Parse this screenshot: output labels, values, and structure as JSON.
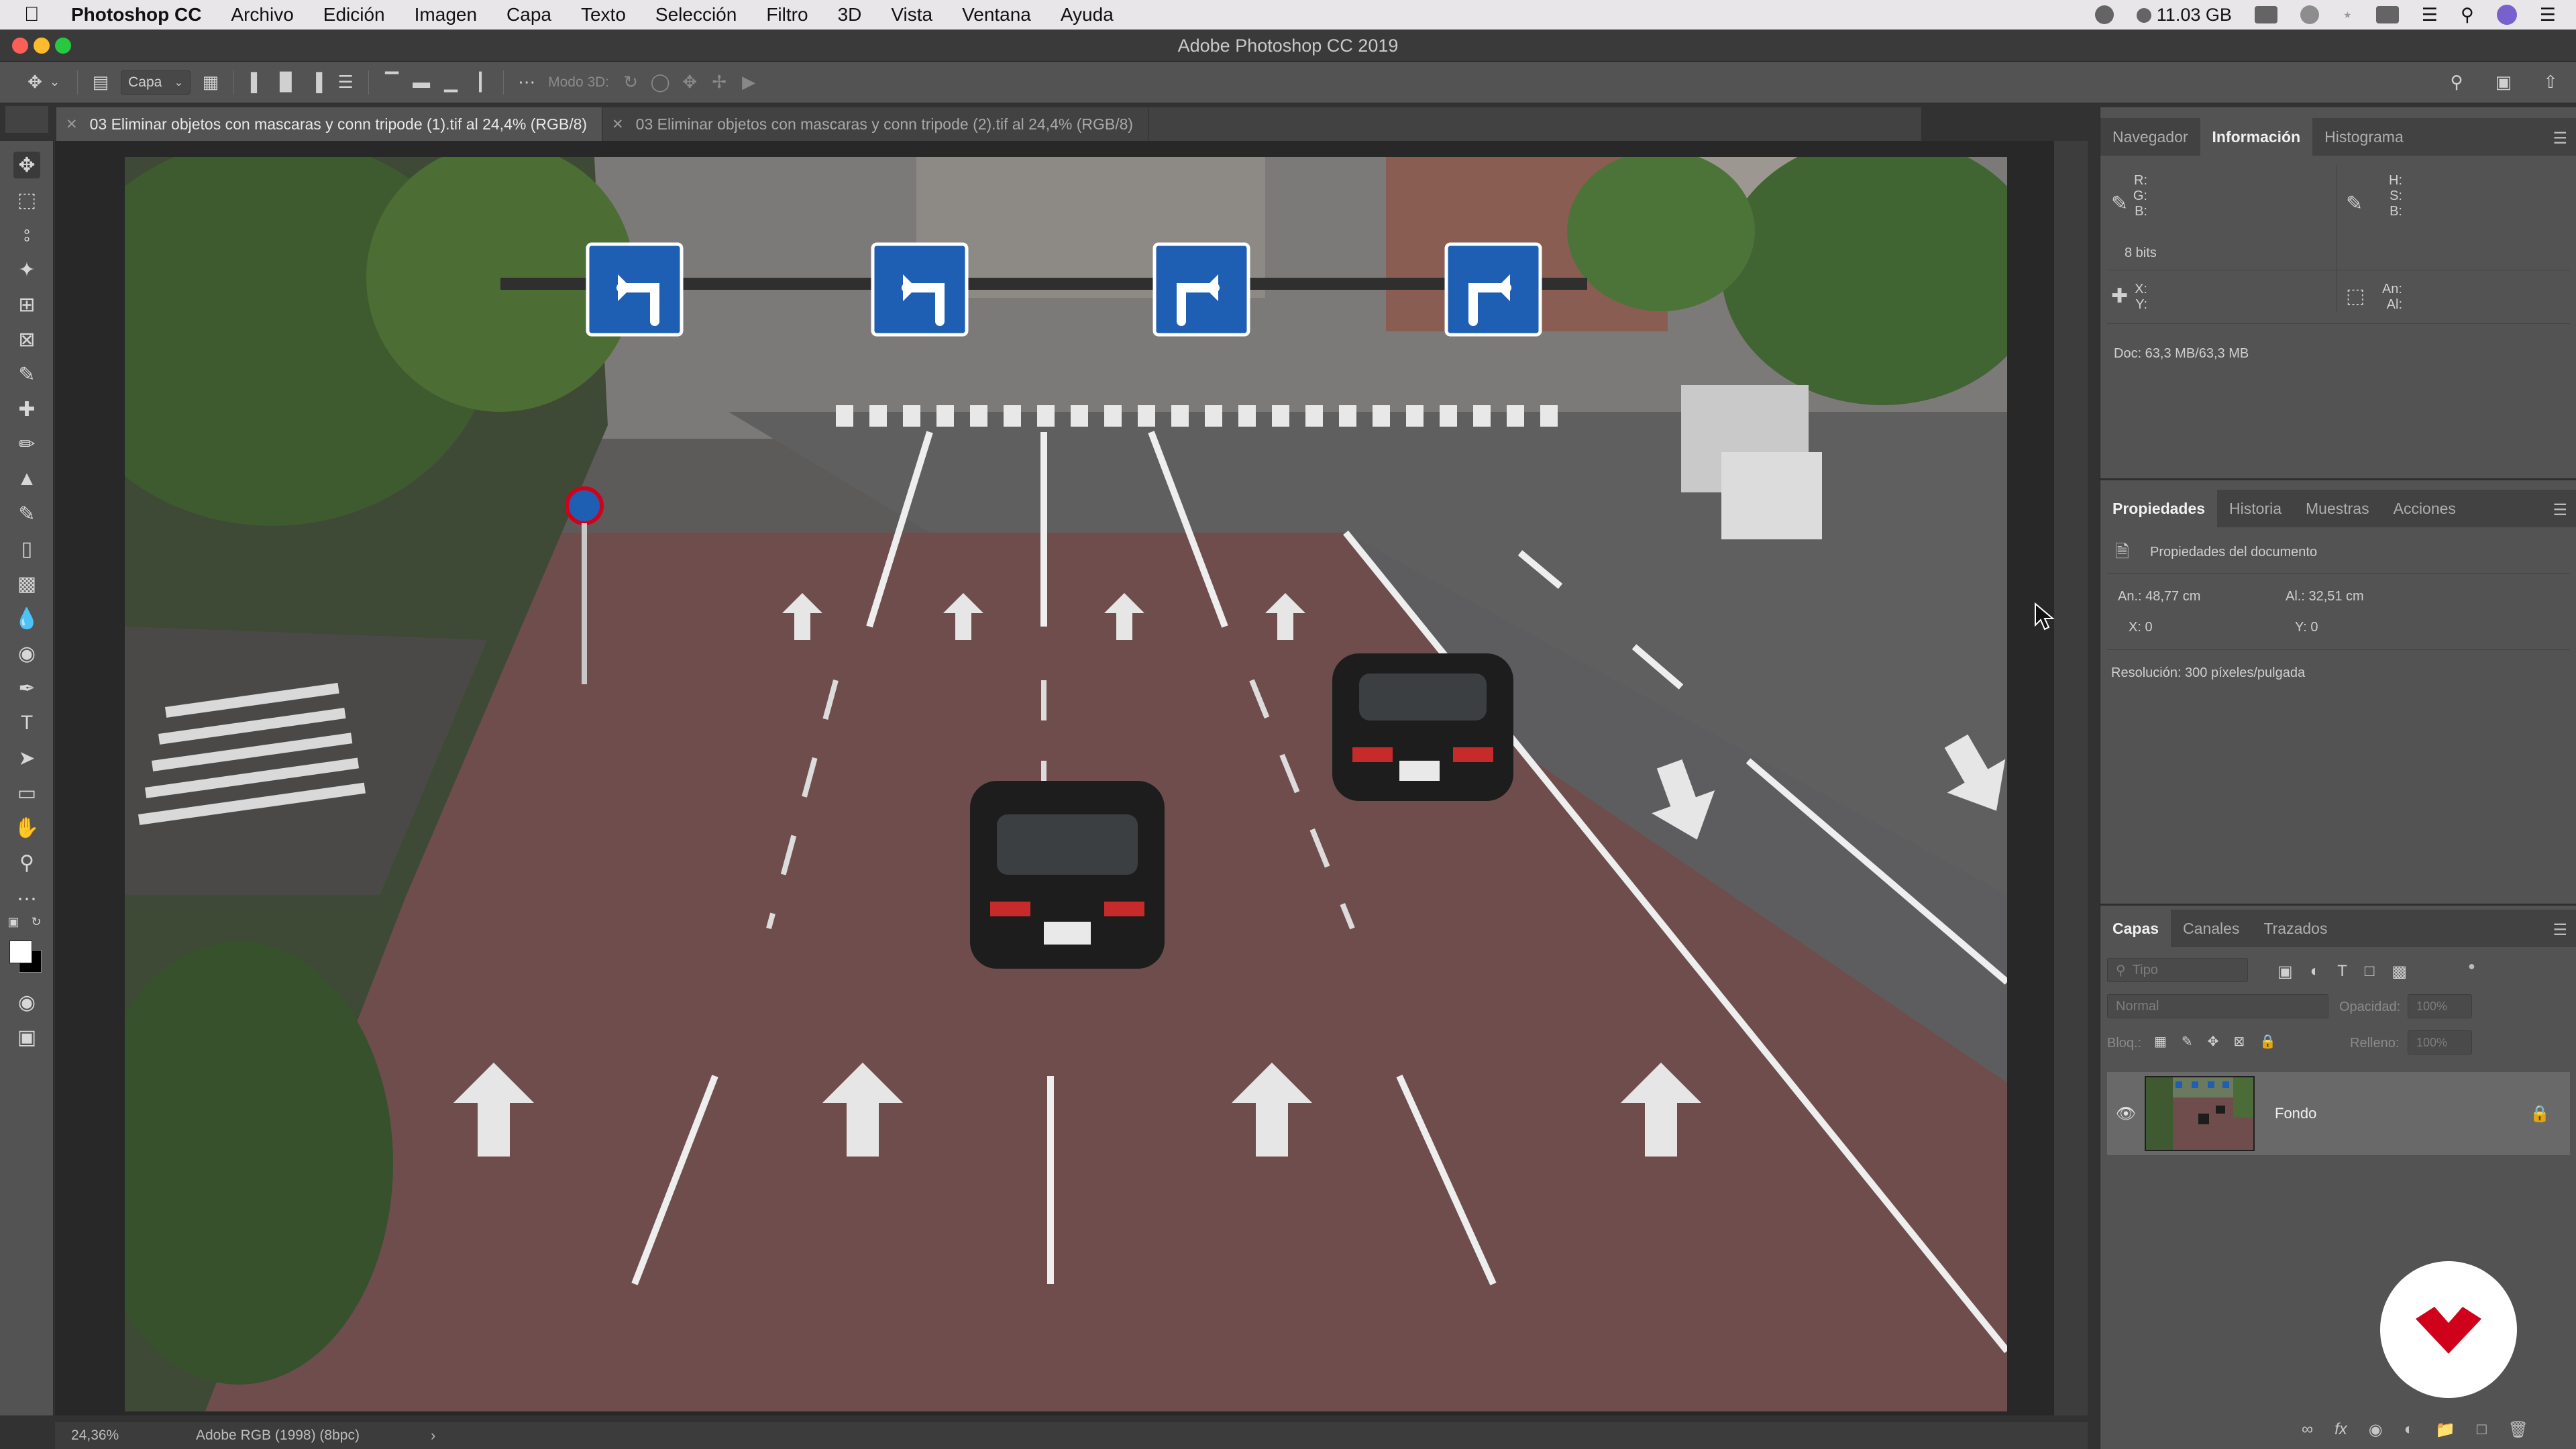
{
  "menubar": {
    "app_name": "Photoshop CC",
    "items": [
      "Archivo",
      "Edición",
      "Imagen",
      "Capa",
      "Texto",
      "Selección",
      "Filtro",
      "3D",
      "Vista",
      "Ventana",
      "Ayuda"
    ],
    "memory": "11.03 GB"
  },
  "window": {
    "title": "Adobe Photoshop CC 2019"
  },
  "options": {
    "layer_select": "Capa",
    "mode3d_label": "Modo 3D:"
  },
  "tabs": [
    {
      "label": "03 Eliminar objetos con mascaras y conn tripode (1).tif al 24,4% (RGB/8)",
      "active": true
    },
    {
      "label": "03 Eliminar objetos con mascaras y conn tripode (2).tif al 24,4% (RGB/8)",
      "active": false
    }
  ],
  "statusbar": {
    "zoom": "24,36%",
    "profile": "Adobe RGB (1998) (8bpc)"
  },
  "info_panel": {
    "tabs": [
      "Navegador",
      "Información",
      "Histograma"
    ],
    "active_tab": "Información",
    "rgb_labels": [
      "R:",
      "G:",
      "B:"
    ],
    "hsb_labels": [
      "H:",
      "S:",
      "B:"
    ],
    "bits": "8 bits",
    "xy_labels": [
      "X:",
      "Y:"
    ],
    "size_labels": [
      "An:",
      "Al:"
    ],
    "doc_size": "Doc: 63,3 MB/63,3 MB"
  },
  "properties_panel": {
    "tabs": [
      "Propiedades",
      "Historia",
      "Muestras",
      "Acciones"
    ],
    "active_tab": "Propiedades",
    "header": "Propiedades del documento",
    "width": "An.: 48,77 cm",
    "height": "Al.: 32,51 cm",
    "x": "X: 0",
    "y": "Y: 0",
    "resolution": "Resolución: 300 píxeles/pulgada"
  },
  "layers_panel": {
    "tabs": [
      "Capas",
      "Canales",
      "Trazados"
    ],
    "active_tab": "Capas",
    "filter_placeholder": "Tipo",
    "blend_mode": "Normal",
    "opacity_label": "Opacidad:",
    "opacity_value": "100%",
    "lock_label": "Bloq.:",
    "fill_label": "Relleno:",
    "fill_value": "100%",
    "layers": [
      {
        "name": "Fondo",
        "visible": true,
        "locked": true
      }
    ]
  },
  "colors": {
    "panel_bg": "#535353",
    "workspace_bg": "#282828",
    "accent_red": "#d0021b"
  }
}
